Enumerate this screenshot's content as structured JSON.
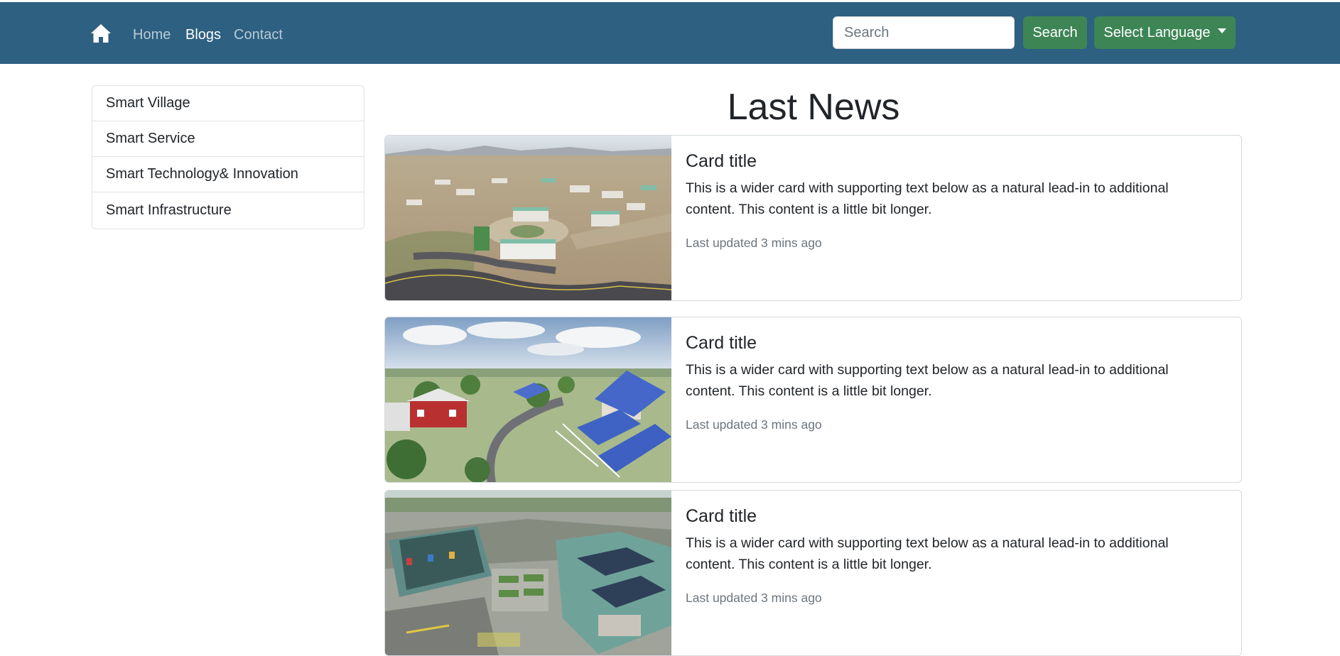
{
  "navbar": {
    "home_icon": "home-icon",
    "links": [
      {
        "label": "Home",
        "active": false
      },
      {
        "label": "Blogs",
        "active": true
      },
      {
        "label": "Contact",
        "active": false
      }
    ],
    "search": {
      "placeholder": "Search",
      "value": ""
    },
    "search_button": "Search",
    "language_button": "Select Language",
    "colors": {
      "background": "#2d6081",
      "button": "#3d8555"
    }
  },
  "sidebar": {
    "items": [
      {
        "label": "Smart Village"
      },
      {
        "label": "Smart Service"
      },
      {
        "label": "Smart Technology& Innovation"
      },
      {
        "label": "Smart Infrastructure"
      }
    ]
  },
  "main": {
    "heading": "Last News",
    "cards": [
      {
        "title": "Card title",
        "text": "This is a wider card with supporting text below as a natural lead-in to additional content. This content is a little bit longer.",
        "updated": "Last updated 3 mins ago"
      },
      {
        "title": "Card title",
        "text": "This is a wider card with supporting text below as a natural lead-in to additional content. This content is a little bit longer.",
        "updated": "Last updated 3 mins ago"
      },
      {
        "title": "Card title",
        "text": "This is a wider card with supporting text below as a natural lead-in to additional content. This content is a little bit longer.",
        "updated": "Last updated 3 mins ago"
      }
    ]
  }
}
